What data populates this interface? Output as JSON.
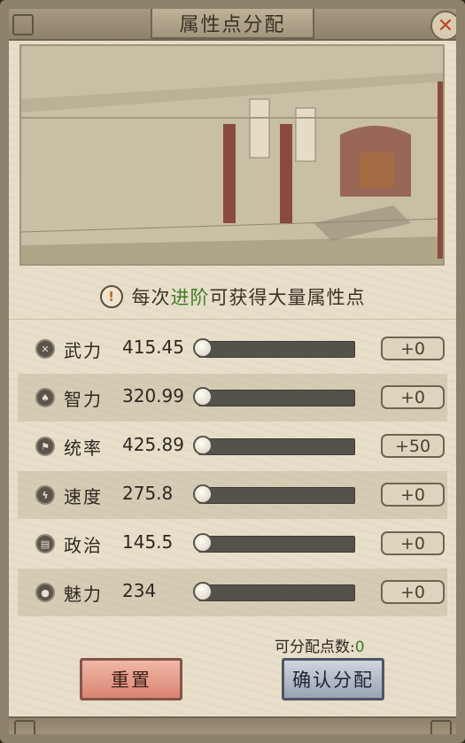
{
  "window": {
    "title": "属性点分配",
    "close_icon": "close-x-icon"
  },
  "scene": {
    "description_icon": "palace-hall-illustration"
  },
  "hint": {
    "prefix": "每次",
    "highlight": "进阶",
    "suffix": "可获得大量属性点",
    "icon": "exclamation-icon"
  },
  "stats": [
    {
      "name": "武力",
      "value": "415.45",
      "plus": "+0",
      "icon": "crossed-swords-icon",
      "slider_fraction": 0
    },
    {
      "name": "智力",
      "value": "320.99",
      "plus": "+0",
      "icon": "flame-icon",
      "slider_fraction": 0
    },
    {
      "name": "统率",
      "value": "425.89",
      "plus": "+50",
      "icon": "banner-icon",
      "slider_fraction": 0
    },
    {
      "name": "速度",
      "value": "275.8",
      "plus": "+0",
      "icon": "lightning-icon",
      "slider_fraction": 0
    },
    {
      "name": "政治",
      "value": "145.5",
      "plus": "+0",
      "icon": "scroll-icon",
      "slider_fraction": 0
    },
    {
      "name": "魅力",
      "value": "234",
      "plus": "+0",
      "icon": "person-icon",
      "slider_fraction": 0
    }
  ],
  "remaining": {
    "label": "可分配点数:",
    "value": "0"
  },
  "buttons": {
    "reset": "重置",
    "confirm": "确认分配"
  },
  "colors": {
    "highlight_green": "#3f7a2a",
    "close_red": "#b8471e",
    "reset_red": "#d98471",
    "confirm_blue": "#9aa3b2"
  }
}
